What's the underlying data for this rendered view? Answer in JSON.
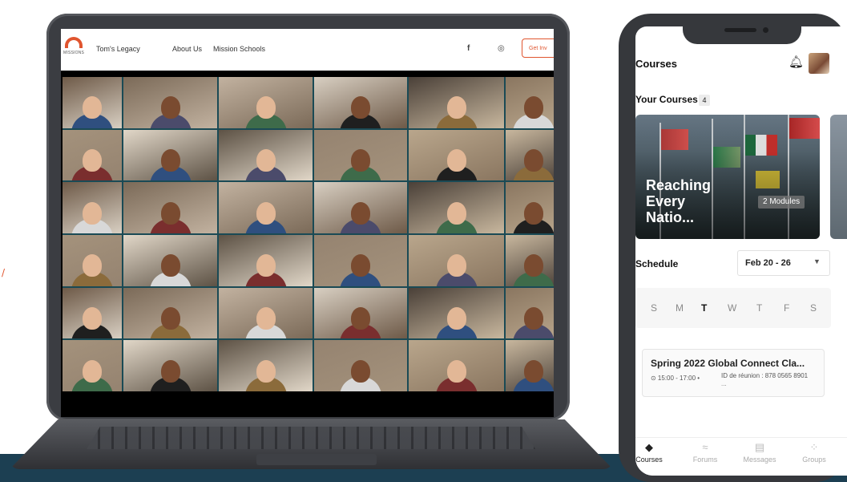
{
  "website": {
    "logo_text": "MISSIONS",
    "nav": [
      "Tom's Legacy",
      "About Us",
      "Mission Schools"
    ],
    "social_icons": [
      "facebook-icon",
      "instagram-icon"
    ],
    "cta_label": "Get Inv"
  },
  "video_call": {
    "participants": 36
  },
  "app": {
    "header_title": "Courses",
    "your_courses_label": "Your Courses",
    "your_courses_count": "4",
    "course_card": {
      "title": "Reaching Every Natio...",
      "modules": "2 Modules"
    },
    "schedule": {
      "label": "Schedule",
      "date_range": "Feb 20 - 26",
      "days": [
        "S",
        "M",
        "T",
        "W",
        "T",
        "F",
        "S"
      ],
      "selected_day_index": 2
    },
    "event": {
      "title": "Spring 2022 Global Connect Cla...",
      "time": "⊙ 15:00 - 17:00 •",
      "meeting_id": "ID de réunion : 878 0565 8901",
      "meeting_more": "..."
    },
    "tabs": [
      {
        "label": "Courses",
        "icon": "courses-icon",
        "active": true
      },
      {
        "label": "Forums",
        "icon": "forums-icon",
        "active": false
      },
      {
        "label": "Messages",
        "icon": "messages-icon",
        "active": false
      },
      {
        "label": "Groups",
        "icon": "groups-icon",
        "active": false
      }
    ]
  },
  "colors": {
    "brand_orange": "#e0552f",
    "band_teal": "#1c3f52",
    "device_gray": "#3b3d42"
  }
}
